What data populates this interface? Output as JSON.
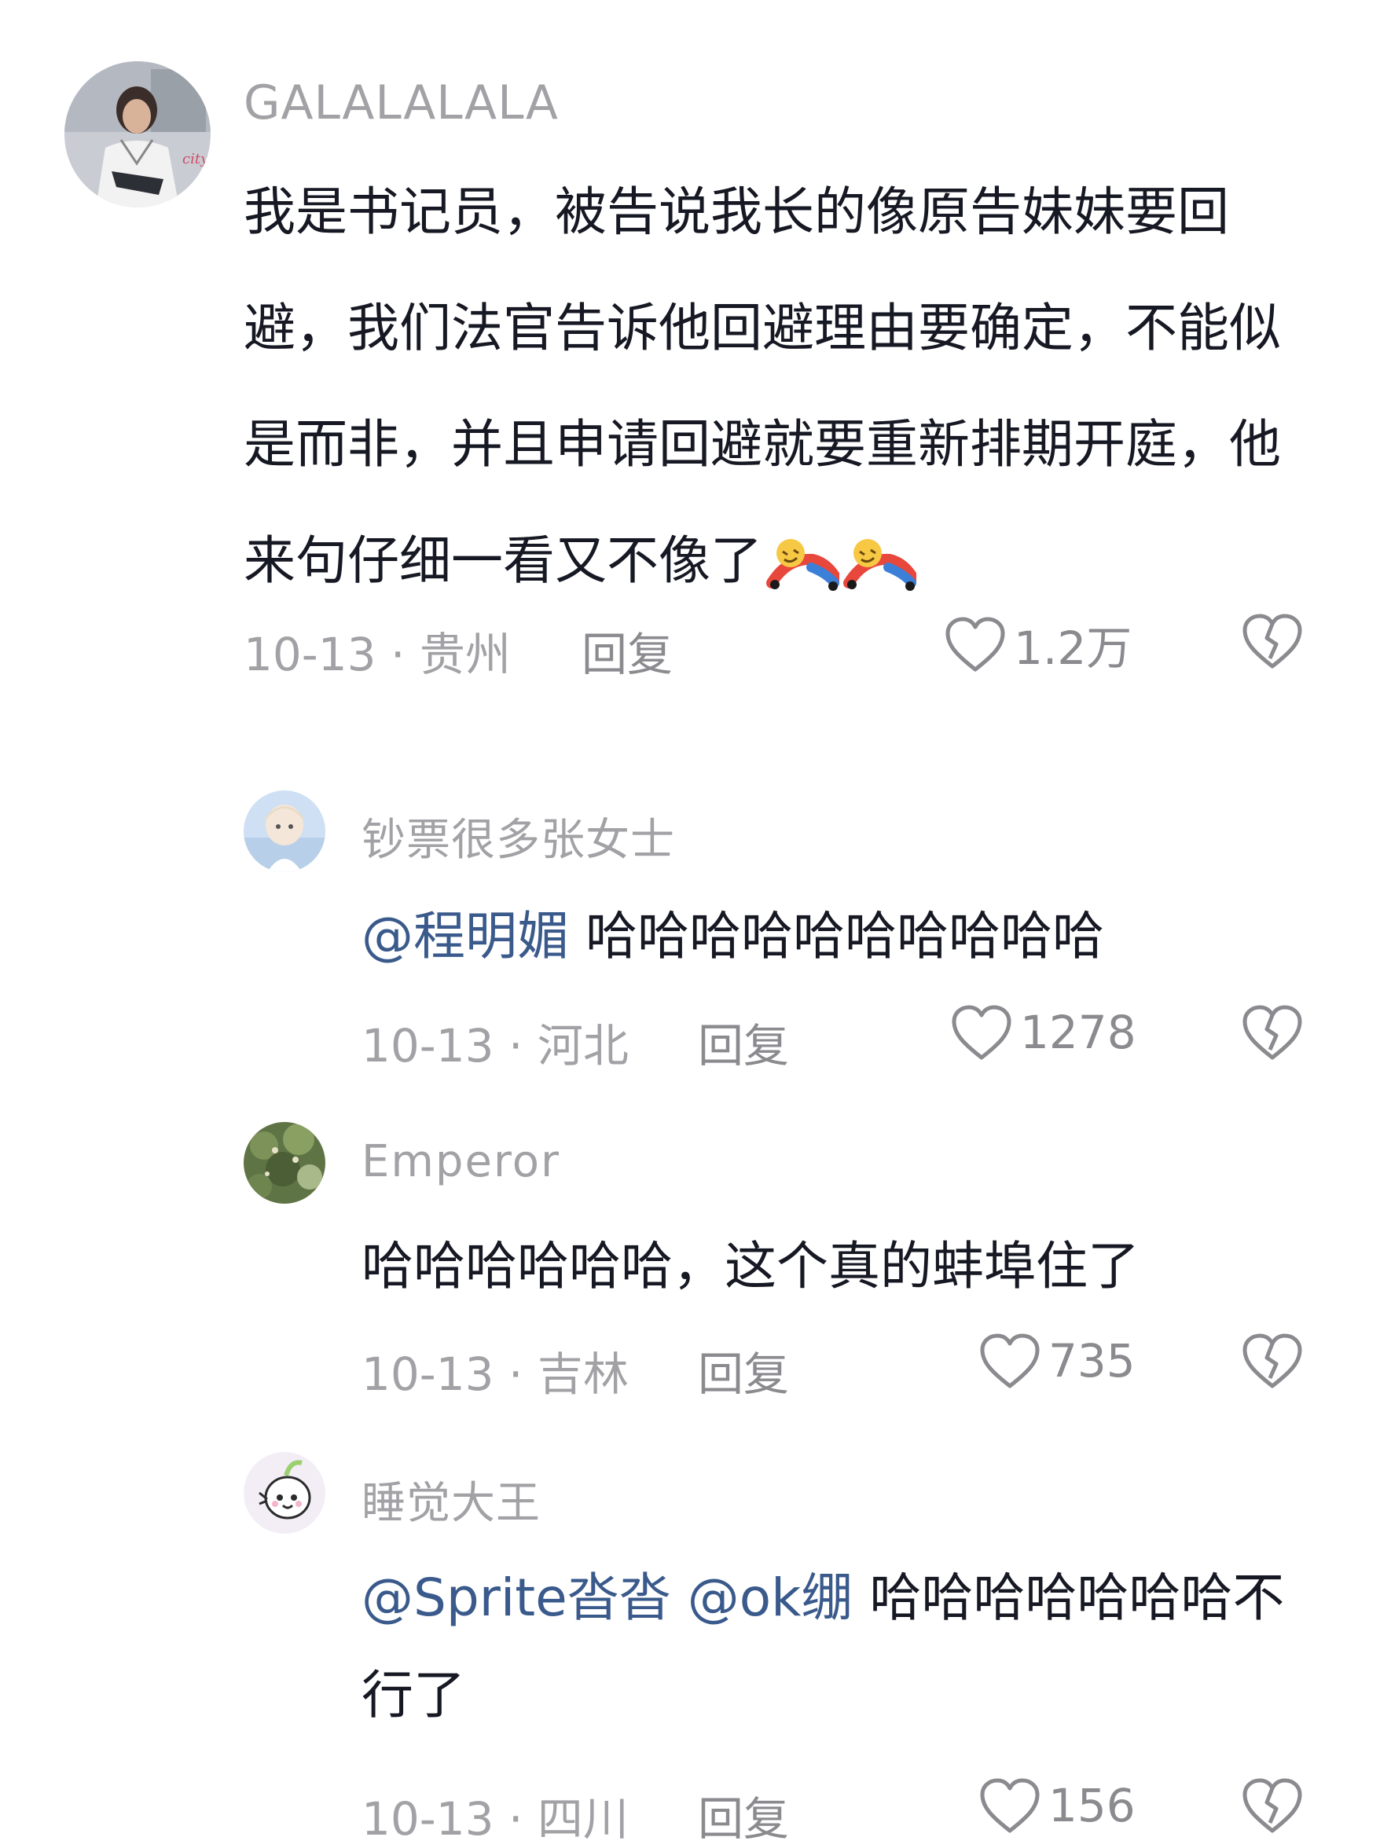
{
  "comments": [
    {
      "username": "GALALALALA",
      "text": "我是书记员，被告说我长的像原告妹妹要回避，我们法官告诉他回避理由要确定，不能似是而非，并且申请回避就要重新排期开庭，他来句仔细一看又不像了",
      "emojis": [
        "laughing-rolling-emoji",
        "laughing-rolling-emoji"
      ],
      "date_location": "10-13 · 贵州",
      "reply_label": "回复",
      "likes": "1.2万"
    }
  ],
  "replies": [
    {
      "username": "钞票很多张女士",
      "mention": "@程明媚",
      "text": " 哈哈哈哈哈哈哈哈哈哈",
      "date_location": "10-13 · 河北",
      "reply_label": "回复",
      "likes": "1278"
    },
    {
      "username": "Emperor",
      "mention": "",
      "text": "哈哈哈哈哈哈，这个真的蚌埠住了",
      "date_location": "10-13 · 吉林",
      "reply_label": "回复",
      "likes": "735"
    },
    {
      "username": "睡觉大王",
      "mention": "@Sprite沓沓",
      "mention2": "@ok绷",
      "text": " 哈哈哈哈哈哈哈不行了",
      "date_location": "10-13 · 四川",
      "reply_label": "回复",
      "likes": "156"
    }
  ],
  "colors": {
    "text": "#161823",
    "muted": "#a2a2a6",
    "mention": "#3a5a8c",
    "icon": "#8a8a8f"
  }
}
